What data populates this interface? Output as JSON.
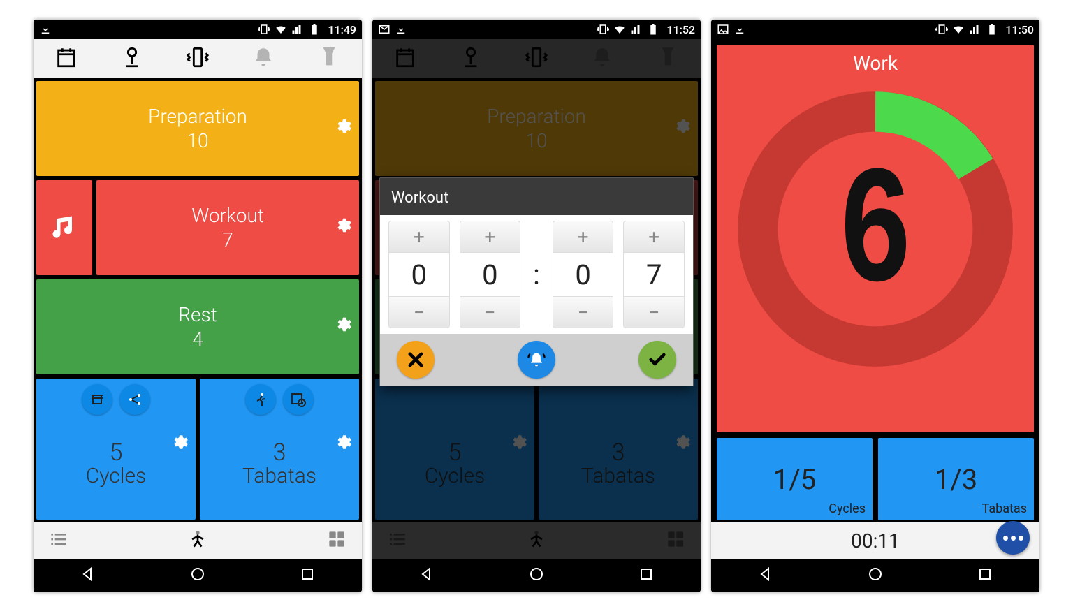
{
  "screen1": {
    "status_time": "11:49",
    "prep_label": "Preparation",
    "prep_value": "10",
    "workout_label": "Workout",
    "workout_value": "7",
    "rest_label": "Rest",
    "rest_value": "4",
    "cycles_value": "5",
    "cycles_label": "Cycles",
    "tabatas_value": "3",
    "tabatas_label": "Tabatas"
  },
  "screen2": {
    "status_time": "11:52",
    "dialog_title": "Workout",
    "d1": "0",
    "d2": "0",
    "d3": "0",
    "d4": "7"
  },
  "screen3": {
    "status_time": "11:50",
    "phase_label": "Work",
    "countdown": "6",
    "cycles_value": "1/5",
    "cycles_label": "Cycles",
    "tabatas_value": "1/3",
    "tabatas_label": "Tabatas",
    "elapsed": "00:11"
  }
}
